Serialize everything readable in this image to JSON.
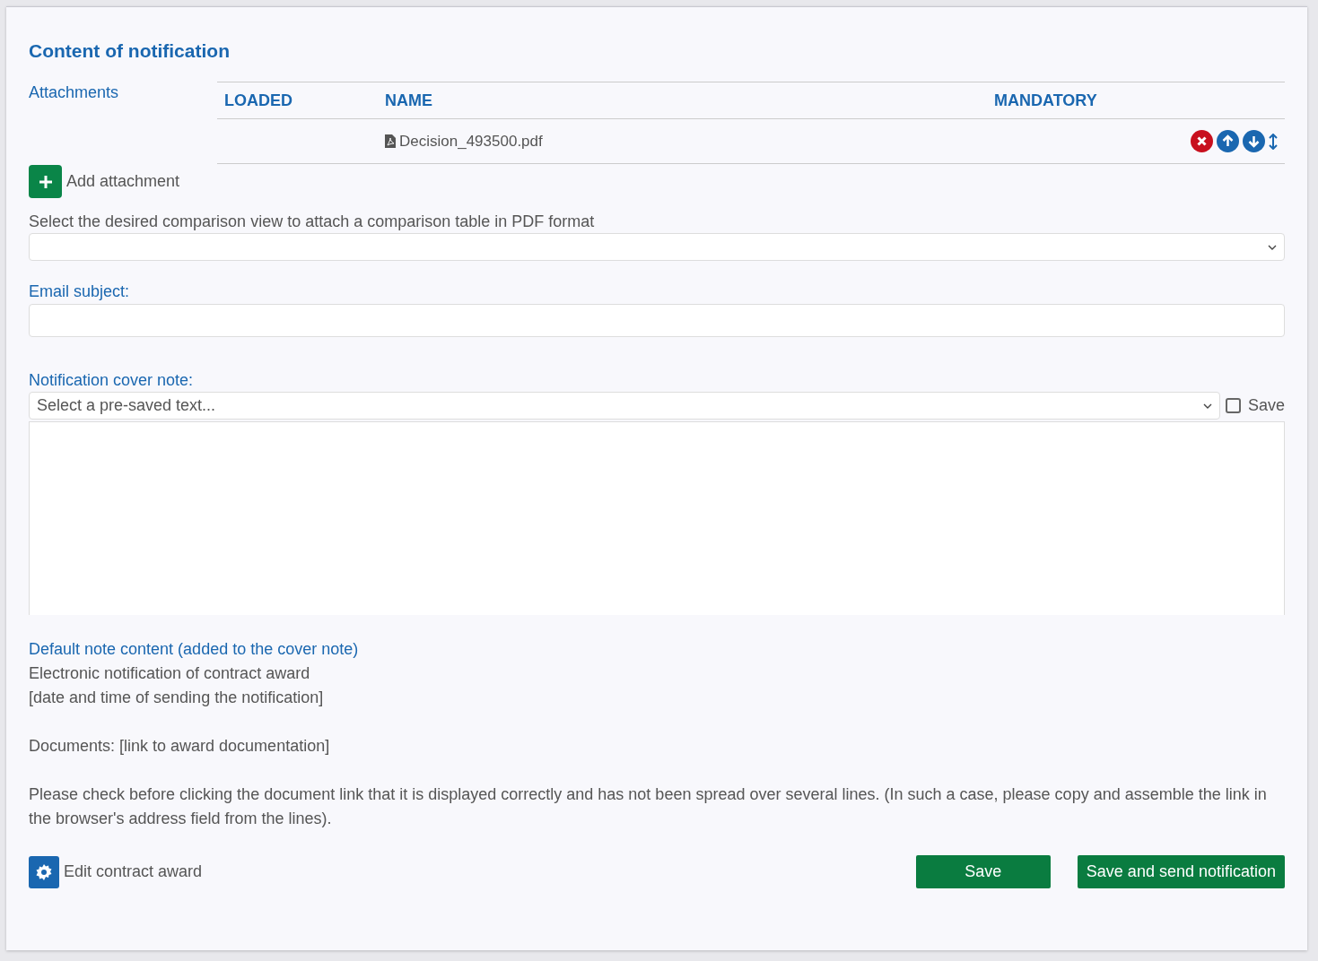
{
  "section_title": "Content of notification",
  "attachments": {
    "label": "Attachments",
    "columns": [
      "LOADED",
      "NAME",
      "MANDATORY"
    ],
    "rows": [
      {
        "name": "Decision_493500.pdf"
      }
    ],
    "add_button": "Add attachment"
  },
  "comparison": {
    "label": "Select the desired comparison view to attach a comparison table in PDF format"
  },
  "email_subject": {
    "label": "Email subject:"
  },
  "cover_note": {
    "label": "Notification cover note:",
    "placeholder": "Select a pre-saved text...",
    "save_checkbox": {
      "label": "Save",
      "checked": false
    }
  },
  "default_note": {
    "title": "Default note content (added to the cover note)",
    "paragraphs": [
      [
        "Electronic notification of contract award",
        "[date and time of sending the notification]"
      ],
      [
        "Documents: [link to award documentation]"
      ],
      [
        "Please check before clicking the document link that it is displayed correctly and has not been spread over several lines. (In such a case, please copy and assemble the link in the browser's address field from the lines)."
      ]
    ]
  },
  "footer": {
    "edit_button": "Edit contract award",
    "save_button": "Save",
    "send_button": "Save and send notification"
  }
}
